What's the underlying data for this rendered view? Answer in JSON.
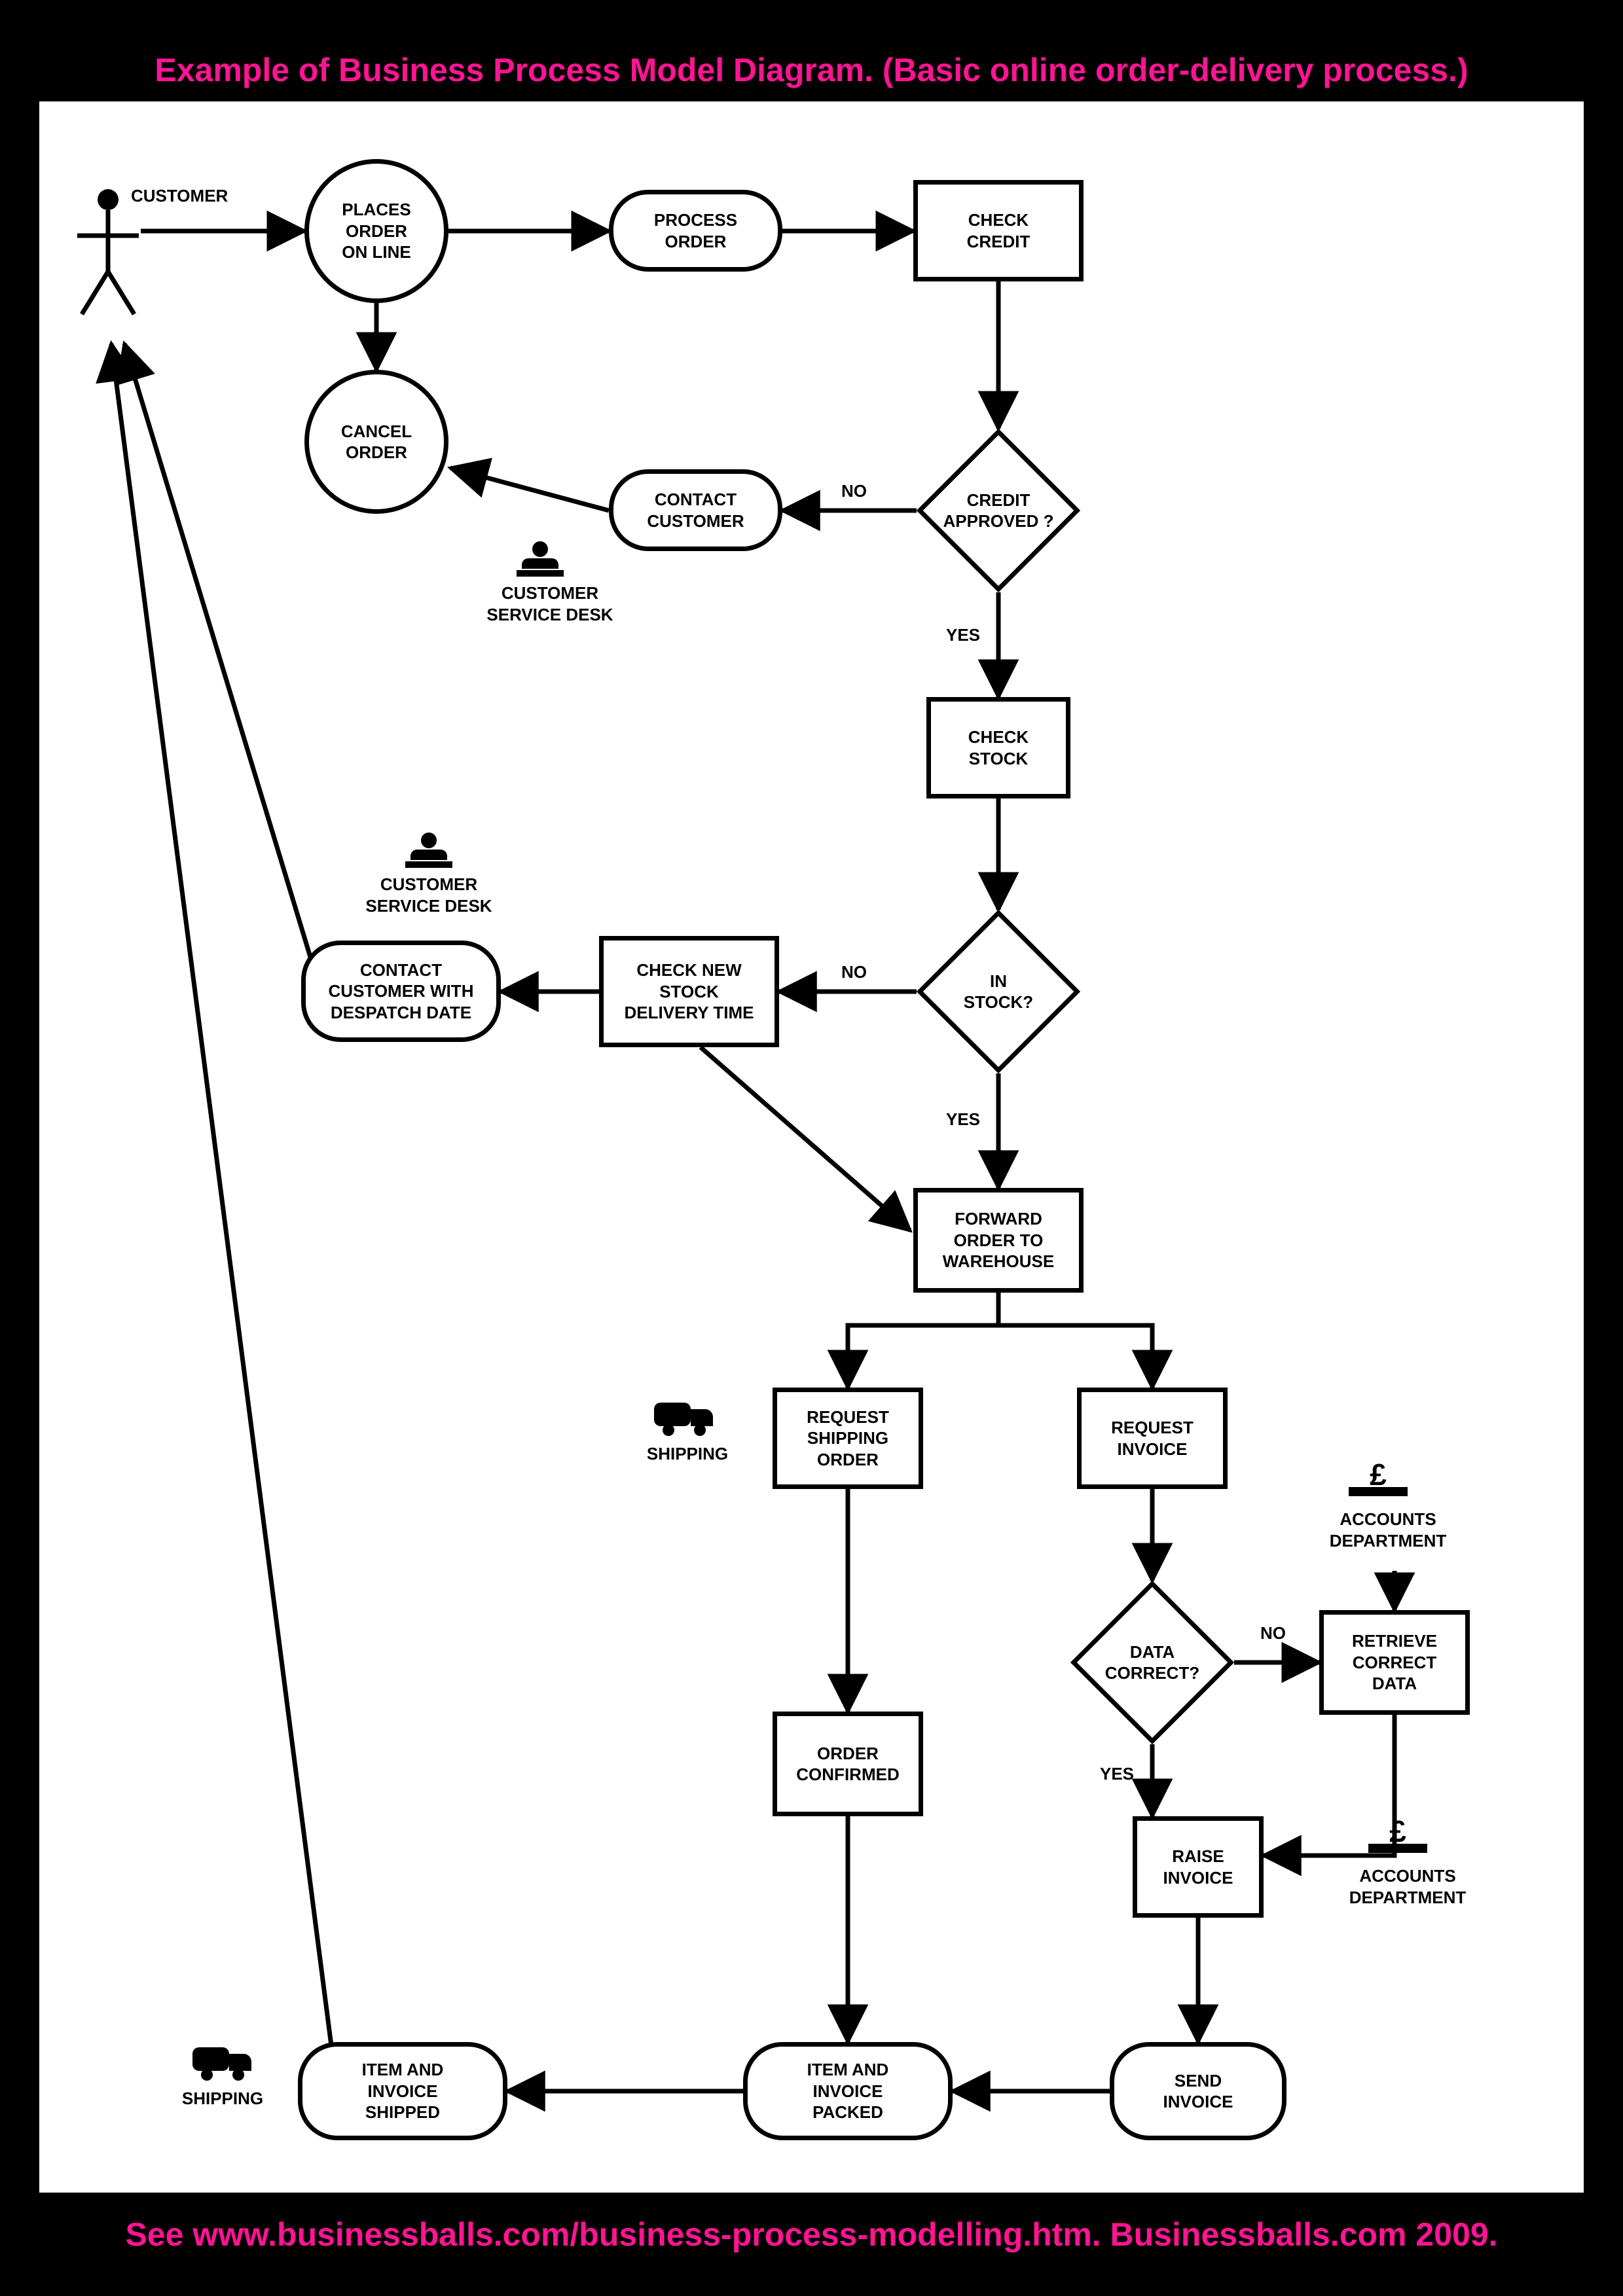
{
  "title": "Example of Business Process Model Diagram. (Basic online order-delivery process.)",
  "footer": "See www.businessballs.com/business-process-modelling.htm.  Businessballs.com 2009.",
  "nodes": {
    "customer": "CUSTOMER",
    "places_order": "PLACES\nORDER\nON LINE",
    "process_order": "PROCESS\nORDER",
    "check_credit": "CHECK\nCREDIT",
    "cancel_order": "CANCEL\nORDER",
    "contact_customer": "CONTACT\nCUSTOMER",
    "credit_approved": "CREDIT\nAPPROVED ?",
    "check_stock": "CHECK\nSTOCK",
    "in_stock": "IN\nSTOCK?",
    "check_new_stock": "CHECK NEW\nSTOCK\nDELIVERY TIME",
    "contact_customer_despatch": "CONTACT\nCUSTOMER WITH\nDESPATCH DATE",
    "forward_order": "FORWARD\nORDER TO\nWAREHOUSE",
    "request_shipping": "REQUEST\nSHIPPING\nORDER",
    "request_invoice": "REQUEST\nINVOICE",
    "data_correct": "DATA\nCORRECT?",
    "retrieve_data": "RETRIEVE\nCORRECT\nDATA",
    "order_confirmed": "ORDER\nCONFIRMED",
    "raise_invoice": "RAISE\nINVOICE",
    "send_invoice": "SEND\nINVOICE",
    "item_invoice_packed": "ITEM AND\nINVOICE\nPACKED",
    "item_invoice_shipped": "ITEM AND\nINVOICE\nSHIPPED"
  },
  "labels": {
    "customer_service_desk": "CUSTOMER\nSERVICE DESK",
    "shipping": "SHIPPING",
    "accounts_department": "ACCOUNTS\nDEPARTMENT",
    "no": "NO",
    "yes": "YES"
  },
  "icons": {
    "pound": "£"
  }
}
